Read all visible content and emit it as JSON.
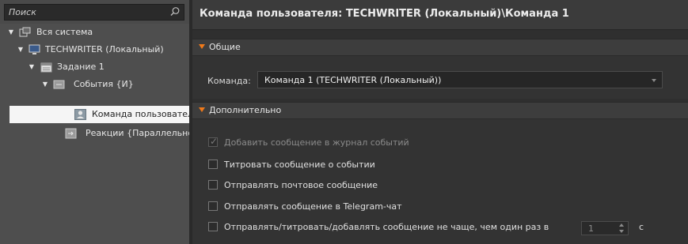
{
  "search": {
    "placeholder": "Поиск",
    "icon": "search-icon"
  },
  "tree": {
    "items": [
      {
        "label": "Вся система",
        "icon": "system-icon",
        "expanded": true
      },
      {
        "label": "TECHWRITER (Локальный)",
        "icon": "computer-icon",
        "expanded": true
      },
      {
        "label": "Задание 1",
        "icon": "calendar-icon",
        "expanded": true
      },
      {
        "label": "События {И}",
        "icon": "events-icon",
        "expanded": true
      },
      {
        "label": "Команда пользователя",
        "icon": "user-command-icon",
        "selected": true
      },
      {
        "label": "Реакции  {Параллельно}",
        "icon": "reactions-icon"
      }
    ]
  },
  "header": {
    "title": "Команда пользователя: TECHWRITER (Локальный)\\Команда 1"
  },
  "sections": {
    "general": {
      "label": "Общие"
    },
    "additional": {
      "label": "Дополнительно"
    }
  },
  "command": {
    "label": "Команда:",
    "value": "Команда 1 (TECHWRITER (Локальный))"
  },
  "options": [
    {
      "label": "Добавить сообщение в журнал событий",
      "checked": true,
      "disabled": true
    },
    {
      "label": "Титровать сообщение о событии",
      "checked": false
    },
    {
      "label": "Отправлять почтовое сообщение",
      "checked": false
    },
    {
      "label": "Отправлять сообщение в Telegram-чат",
      "checked": false
    },
    {
      "label": "Отправлять/титровать/добавлять сообщение не чаще, чем один раз в",
      "checked": false
    }
  ],
  "interval": {
    "value": "1",
    "unit": "с"
  },
  "colors": {
    "accent": "#f07a1a",
    "selected_row": "#f5f5f5",
    "background": "#2f2f2f"
  }
}
